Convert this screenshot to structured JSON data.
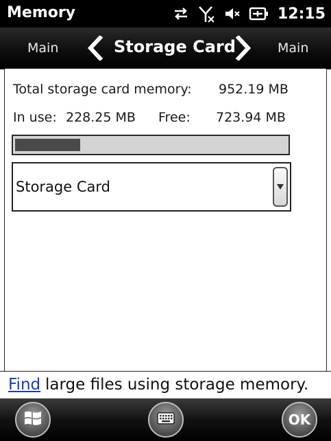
{
  "status_bar": {
    "app_title": "Memory",
    "time": "12:15",
    "icons": [
      "sync-arrows-icon",
      "no-signal-icon",
      "volume-mute-icon",
      "battery-charging-icon"
    ]
  },
  "nav": {
    "left_label": "Main",
    "title": "Storage Card",
    "right_label": "Main"
  },
  "memory": {
    "total_label": "Total storage card memory:",
    "total_value": "952.19 MB",
    "in_use_label": "In use:",
    "in_use_value": "228.25 MB",
    "free_label": "Free:",
    "free_value": "723.94 MB",
    "usage_fraction": 0.24
  },
  "dropdown": {
    "selected": "Storage Card"
  },
  "footer": {
    "link_text": "Find",
    "rest_text": "large files using storage memory."
  },
  "bottom_bar": {
    "start_icon": "windows-start-icon",
    "keyboard_icon": "keyboard-icon",
    "ok_label": "OK"
  },
  "colors": {
    "link": "#1d3ba8",
    "usage_fill": "#4a4a4a"
  }
}
